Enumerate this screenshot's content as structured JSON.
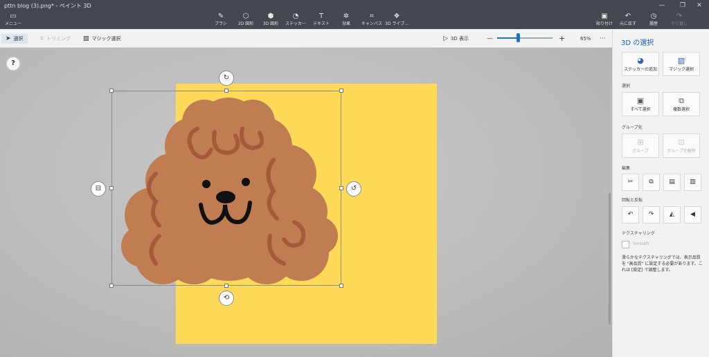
{
  "window": {
    "title": "pttn blog (3).png* - ペイント 3D",
    "controls": [
      "—",
      "❐",
      "✕"
    ]
  },
  "menu": {
    "label": "メニュー",
    "icon": "folder-icon"
  },
  "tools": [
    {
      "label": "ブラシ",
      "icon": "brush-icon"
    },
    {
      "label": "2D 図形",
      "icon": "2d-shapes-icon"
    },
    {
      "label": "3D 図形",
      "icon": "3d-shapes-icon"
    },
    {
      "label": "ステッカー",
      "icon": "sticker-icon"
    },
    {
      "label": "テキスト",
      "icon": "text-icon"
    },
    {
      "label": "効果",
      "icon": "effects-icon"
    },
    {
      "label": "キャンバス",
      "icon": "canvas-icon"
    },
    {
      "label": "3D ライブ...",
      "icon": "3d-library-icon"
    }
  ],
  "right_tools": [
    {
      "label": "貼り付け",
      "icon": "paste-icon"
    },
    {
      "label": "元に戻す",
      "icon": "undo-icon"
    },
    {
      "label": "履歴",
      "icon": "history-icon"
    },
    {
      "label": "やり直し",
      "icon": "redo-icon"
    }
  ],
  "subbar": {
    "select": "選択",
    "crop": "トリミング",
    "magic_select": "マジック選択",
    "view_3d": "3D 表示",
    "zoom_minus": "—",
    "zoom_plus": "+",
    "zoom_level": "65%",
    "zoom_value": 0.38,
    "more": "···"
  },
  "canvas": {
    "help": "?",
    "paper_color": "#ffd958",
    "fur_color": "#c17d52",
    "curl_color": "#a55a3a"
  },
  "panel": {
    "title": "3D の選択",
    "add_sticker": "ステッカーの追加",
    "magic_select": "マジック選択",
    "section_select": "選択",
    "select_all": "すべて選択",
    "multi_select": "複数選択",
    "section_group": "グループ化",
    "group": "グループ",
    "ungroup": "グループを解除",
    "section_edit": "編集",
    "section_rotate": "回転と反転",
    "section_texture": "テクスチャリング",
    "smooth": "Smooth",
    "note": "滑らかなテクスチャリングでは、表示品質を \"高品質\" に設定する必要があります。これは [設定] で調整します。"
  },
  "colors": {
    "accent": "#1a5fae",
    "toolbar_bg": "#44474d"
  }
}
